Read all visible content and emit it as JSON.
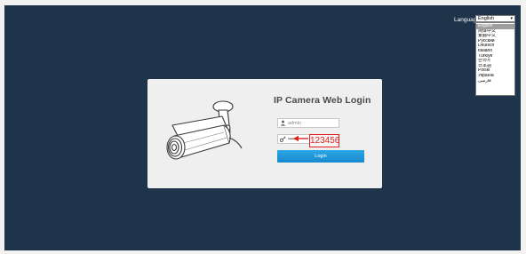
{
  "language": {
    "label": "Language",
    "selected": "English",
    "options": [
      "English",
      "简体中文",
      "繁體中文",
      "Русский",
      "Deutsch",
      "Italiano",
      "Türkiye",
      "한국어",
      "日本語",
      "Polski",
      "Україна",
      "فارسی"
    ]
  },
  "login": {
    "title": "IP Camera Web Login",
    "username_value": "admin",
    "password_masked": "•••••",
    "button_label": "Login"
  },
  "annotation": {
    "password_text": "123456"
  },
  "colors": {
    "background": "#1e344a",
    "panel": "#efefef",
    "button": "#1e98dc",
    "annotation": "#e02020"
  }
}
